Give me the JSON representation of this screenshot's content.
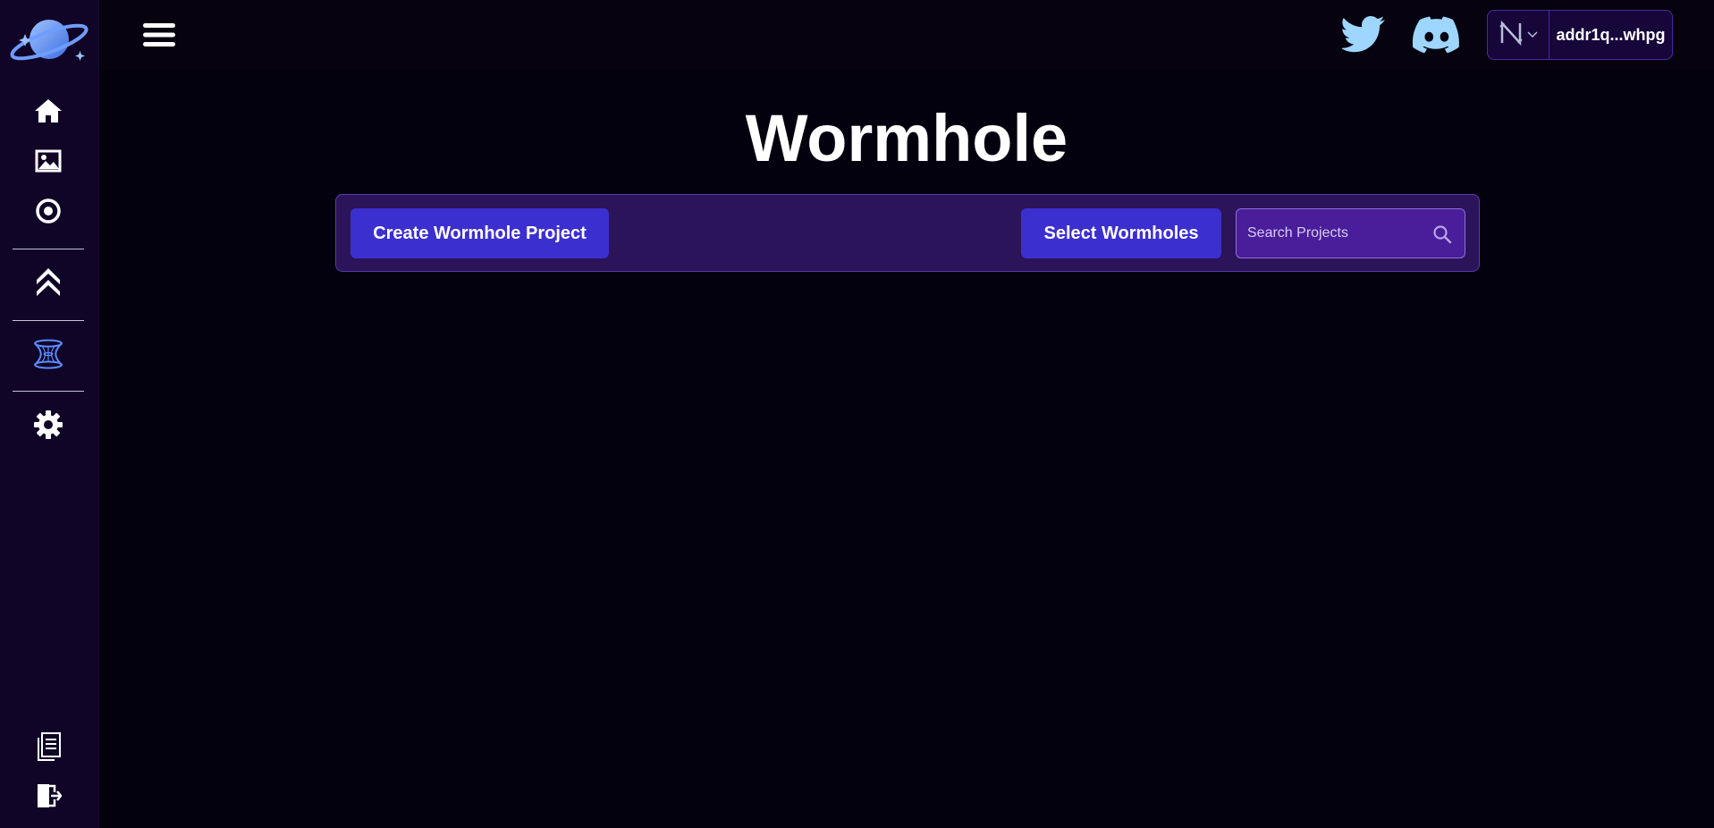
{
  "app": {
    "title": "Wormhole"
  },
  "sidebar": {
    "items": [
      {
        "icon": "home-icon"
      },
      {
        "icon": "image-icon"
      },
      {
        "icon": "compass-icon"
      },
      {
        "icon": "chevrons-up-icon"
      },
      {
        "icon": "wormhole-icon"
      },
      {
        "icon": "gear-icon"
      },
      {
        "icon": "documents-icon"
      },
      {
        "icon": "logout-icon"
      }
    ]
  },
  "header": {
    "menu_icon": "hamburger-icon",
    "social": [
      "twitter-icon",
      "discord-icon"
    ],
    "wallet": {
      "provider_icon": "nami-wallet-icon",
      "address": "addr1q...whpg"
    }
  },
  "toolbar": {
    "create_label": "Create Wormhole Project",
    "select_label": "Select Wormholes",
    "search_placeholder": "Search Projects",
    "search_value": ""
  },
  "colors": {
    "background": "#04010f",
    "sidebar": "#100427",
    "toolbar": "#2b1459",
    "button": "#3c2fcf",
    "search": "#4a1d9a",
    "accent_blue": "#5b8cff",
    "social": "#9ed6ff"
  }
}
